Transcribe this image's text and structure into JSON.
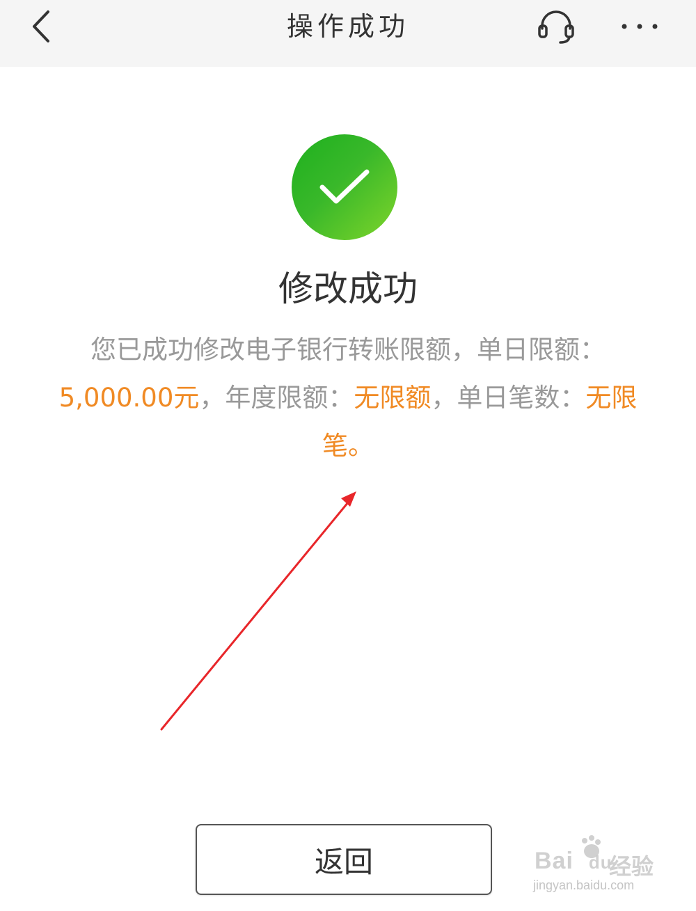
{
  "header": {
    "title": "操作成功",
    "back_icon": "chevron-left-icon",
    "service_icon": "headset-icon",
    "more_icon": "more-horizontal-icon"
  },
  "result": {
    "icon": "check-circle-icon",
    "title": "修改成功",
    "desc_prefix": "您已成功修改电子银行转账限额，单日限额：",
    "daily_limit": "5,000.00元",
    "sep1": "，年度限额：",
    "annual_limit": "无限额",
    "sep2": "，单日笔数：",
    "daily_count": "无限笔",
    "desc_suffix": "。"
  },
  "actions": {
    "return_label": "返回"
  },
  "watermark": {
    "brand": "Bai",
    "brand_tail": "du",
    "cn": "经验",
    "url": "jingyan.baidu.com"
  },
  "colors": {
    "header_bg": "#f5f5f5",
    "success_green": "#2fb52a",
    "highlight_orange": "#f08a24",
    "muted_text": "#999999",
    "annotation_red": "#e8262a"
  }
}
